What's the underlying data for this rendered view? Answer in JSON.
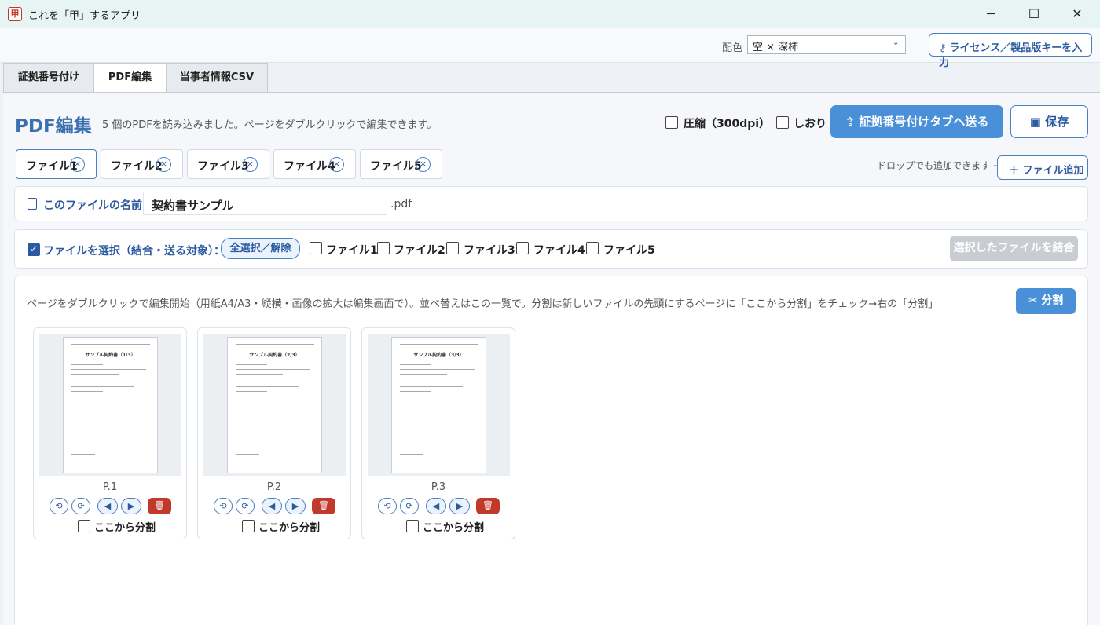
{
  "window": {
    "title": "これを「甲」するアプリ",
    "icon_glyph": "甲",
    "minimize": "─",
    "maximize": "☐",
    "close": "✕"
  },
  "header": {
    "scheme_label": "配色",
    "scheme_value": "空 × 深柿",
    "scheme_arrow": "⌄",
    "license_button": "ライセンス／製品版キーを入力",
    "license_icon": "key-icon"
  },
  "tabs": [
    {
      "label": "証拠番号付け",
      "active": false
    },
    {
      "label": "PDF編集",
      "active": true
    },
    {
      "label": "当事者情報CSV",
      "active": false
    }
  ],
  "pdf_edit": {
    "title": "PDF編集",
    "status": "5 個のPDFを読み込みました。ページをダブルクリックで編集できます。",
    "compress": {
      "label": "圧縮（300dpi）",
      "checked": false
    },
    "bookmark": {
      "label": "しおり",
      "checked": false
    },
    "send_button": "証拠番号付けタブへ送る",
    "save_button": "保存",
    "file_tabs": [
      {
        "label": "ファイル1",
        "selected": true
      },
      {
        "label": "ファイル2",
        "selected": false
      },
      {
        "label": "ファイル3",
        "selected": false
      },
      {
        "label": "ファイル4",
        "selected": false
      },
      {
        "label": "ファイル5",
        "selected": false
      }
    ],
    "close_glyph": "×",
    "drop_hint": "ドロップでも追加できます →",
    "add_file_button": "＋ ファイル追加",
    "file_name": {
      "label": "このファイルの名前：",
      "value": "契約書サンプル",
      "extension": ".pdf"
    },
    "file_select": {
      "label": "ファイルを選択（結合・送る対象）：",
      "checked": true,
      "select_all": "全選択／解除",
      "files": [
        "ファイル1",
        "ファイル2",
        "ファイル3",
        "ファイル4",
        "ファイル5"
      ],
      "merge_button": "選択したファイルを結合"
    },
    "instructions": "ページをダブルクリックで編集開始（用紙A4/A3・縦横・画像の拡大は編集画面で）。並べ替えはこの一覧で。分割は新しいファイルの先頭にするページに「ここから分割」をチェック→右の「分割」",
    "split_button": "分割",
    "pages": [
      {
        "label": "P.1",
        "thumb_title": "サンプル契約書（1/3）",
        "split_label": "ここから分割"
      },
      {
        "label": "P.2",
        "thumb_title": "サンプル契約書（2/3）",
        "split_label": "ここから分割"
      },
      {
        "label": "P.3",
        "thumb_title": "サンプル契約書（3/3）",
        "split_label": "ここから分割"
      }
    ],
    "page_controls": {
      "rotate_left": "⟲",
      "rotate_right": "⟳",
      "move_left": "◀",
      "move_right": "▶",
      "delete": "🗑"
    }
  },
  "colors": {
    "accent": "#4a90d9",
    "accent_dark": "#2c5aa0",
    "danger": "#c0392b",
    "titlebar": "#e6f4f4"
  }
}
